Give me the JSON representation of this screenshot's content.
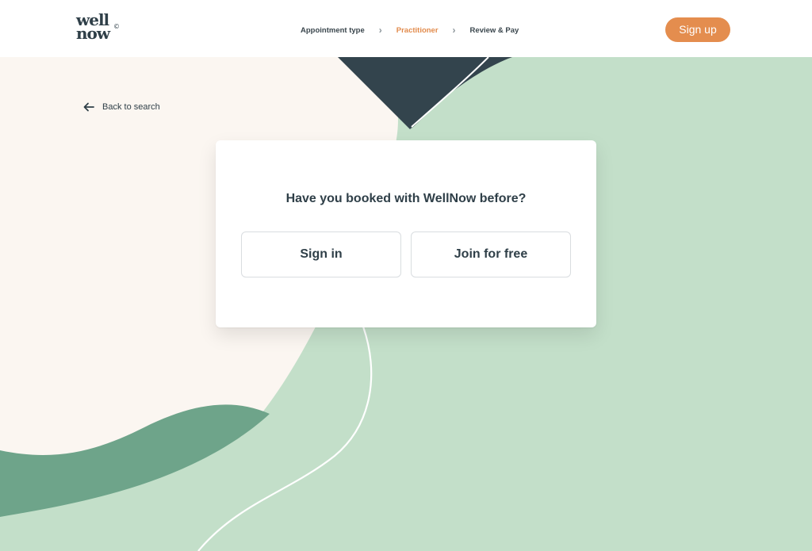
{
  "brand": {
    "logo_top": "well",
    "logo_bottom": "now",
    "logo_mark": "©"
  },
  "header": {
    "steps": [
      {
        "label": "Appointment type",
        "active": false
      },
      {
        "label": "Practitioner",
        "active": true
      },
      {
        "label": "Review & Pay",
        "active": false
      }
    ],
    "separator_icon": "chevron-right-icon",
    "signup_label": "Sign up"
  },
  "navigation": {
    "back_label": "Back to search",
    "back_icon": "arrow-left-icon"
  },
  "card": {
    "title": "Have you booked with WellNow before?",
    "signin_label": "Sign in",
    "join_label": "Join for free"
  },
  "colors": {
    "accent": "#e48d4e",
    "text": "#2f3f48",
    "mint": "#c3dfc9",
    "cream": "#fbf6f1",
    "dark_green": "#6ea48a",
    "slate": "#33444d",
    "white": "#ffffff"
  }
}
